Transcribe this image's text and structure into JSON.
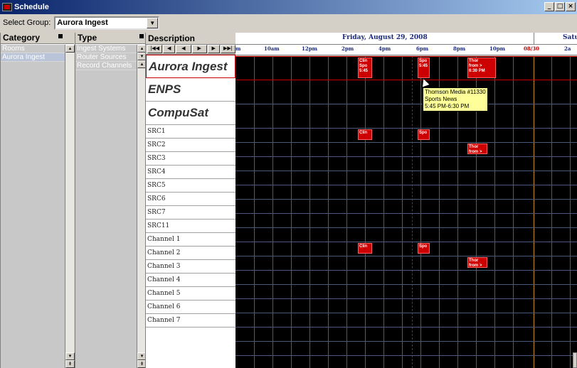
{
  "window": {
    "title": "Schedule",
    "buttons": [
      "_",
      "□",
      "×"
    ]
  },
  "group_select": {
    "label": "Select Group:",
    "value": "Aurora Ingest"
  },
  "category_panel": {
    "header": "Category",
    "items": [
      {
        "label": "Rooms",
        "selected": false
      },
      {
        "label": "Aurora Ingest",
        "selected": true
      }
    ]
  },
  "type_panel": {
    "header": "Type",
    "items": [
      {
        "label": "Ingest Systems"
      },
      {
        "label": "Router Sources"
      },
      {
        "label": "Record Channels"
      }
    ]
  },
  "description_panel": {
    "header": "Description",
    "nav_buttons": [
      "|◀◀",
      "◀",
      "◀",
      "▶",
      "▶",
      "▶▶|"
    ],
    "groups": [
      {
        "label": "Aurora Ingest",
        "selected": true
      },
      {
        "label": "ENPS",
        "selected": false
      },
      {
        "label": "CompuSat",
        "selected": false
      }
    ],
    "rows": [
      "SRC1",
      "SRC2",
      "SRC3",
      "SRC4",
      "SRC5",
      "SRC6",
      "SRC7",
      "SRC11",
      "Channel 1",
      "Channel 2",
      "Channel 3",
      "Channel 4",
      "Channel 5",
      "Channel 6",
      "Channel 7"
    ]
  },
  "timeline": {
    "day1": "Friday, August 29, 2008",
    "day2": "Satu",
    "hours": [
      "m",
      "10am",
      "12pm",
      "2pm",
      "4pm",
      "6pm",
      "8pm",
      "10pm",
      "08/30",
      "2a"
    ],
    "events": {
      "aurora_e1": "Clin\nSpo\n5:45",
      "aurora_e2": "Spo\n5:45",
      "aurora_e3": "Thor\nfrom >\n6:30 PM",
      "src1_e1": "Clin",
      "src1_e2": "Spo",
      "src2_e1": "Thor\nfrom >",
      "ch1_e1": "Clin",
      "ch1_e2": "Spo",
      "ch2_e1": "Thor\nfrom >"
    }
  },
  "tooltip": {
    "line1": "Thomson Media #11330",
    "line2": "Sports News",
    "line3": "5:45 PM-6:30 PM"
  },
  "colors": {
    "grid_bg": "#000000",
    "event_red": "#cc0000",
    "selection": "#cc0000",
    "day_divider": "#c89020",
    "tooltip_bg": "#ffff99"
  }
}
